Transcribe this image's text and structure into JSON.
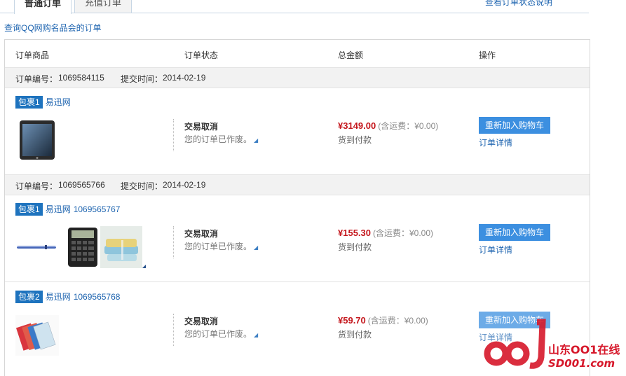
{
  "tabs": [
    {
      "label": "普通订单",
      "active": true
    },
    {
      "label": "充值订单",
      "active": false
    }
  ],
  "status_help_link": "查看订单状态说明",
  "qq_link": "查询QQ网购名品会的订单",
  "table_headers": [
    "订单商品",
    "订单状态",
    "总金额",
    "操作"
  ],
  "order_no_label": "订单编号：",
  "submit_time_label": "提交时间：",
  "orders": [
    {
      "number": "1069584115",
      "date": "2014-02-19",
      "package": "包裹1",
      "vendor": "易迅网",
      "package_id": "",
      "products": [
        "ipad-thumbnail"
      ],
      "status": "交易取消",
      "status_sub": "您的订单已作废。",
      "price": "¥3149.00",
      "shipping": "(含运费：¥0.00)",
      "payment": "货到付款",
      "readd_label": "重新加入购物车",
      "detail_label": "订单详情"
    },
    {
      "number": "1069565766",
      "date": "2014-02-19",
      "package": "包裹1",
      "vendor": "易迅网",
      "package_id": "1069565767",
      "products": [
        "pen-thumbnail",
        "calculator-thumbnail",
        "towels-thumbnail"
      ],
      "status": "交易取消",
      "status_sub": "您的订单已作废。",
      "price": "¥155.30",
      "shipping": "(含运费：¥0.00)",
      "payment": "货到付款",
      "readd_label": "重新加入购物车",
      "detail_label": "订单详情"
    },
    {
      "number": "",
      "date": "",
      "package": "包裹2",
      "vendor": "易迅网",
      "package_id": "1069565768",
      "products": [
        "folders-thumbnail"
      ],
      "status": "交易取消",
      "status_sub": "您的订单已作废。",
      "price": "¥59.70",
      "shipping": "(含运费：¥0.00)",
      "payment": "货到付款",
      "readd_label": "重新加入购物车",
      "detail_label": "订单详情"
    }
  ],
  "watermark": {
    "cn": "山东OO1在线",
    "en": "SD001.com"
  },
  "colors": {
    "accent": "#1e73be",
    "price": "#c4161c",
    "button": "#3c8fe0",
    "watermark": "#d6172a"
  }
}
